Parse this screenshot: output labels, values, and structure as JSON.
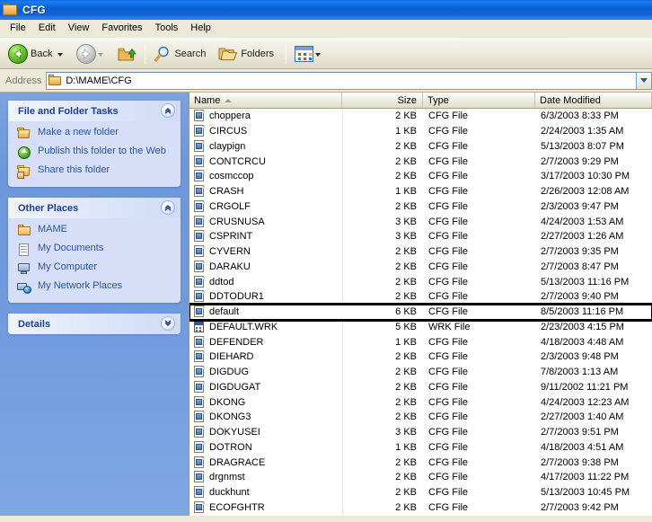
{
  "window": {
    "title": "CFG",
    "folder_icon": "folder-icon"
  },
  "menu": {
    "items": [
      {
        "label": "File"
      },
      {
        "label": "Edit"
      },
      {
        "label": "View"
      },
      {
        "label": "Favorites"
      },
      {
        "label": "Tools"
      },
      {
        "label": "Help"
      }
    ]
  },
  "toolbar": {
    "back_label": "Back",
    "search_label": "Search",
    "folders_label": "Folders",
    "back_icon": "back-arrow-icon",
    "forward_icon": "forward-arrow-icon",
    "up_icon": "up-one-level-icon",
    "search_icon": "search-magnifier-icon",
    "folders_icon": "folders-icon",
    "views_icon": "views-icon"
  },
  "address": {
    "label": "Address",
    "value": "D:\\MAME\\CFG",
    "folder_icon": "folder-icon",
    "dropdown_icon": "chevron-down-icon"
  },
  "sidebar": {
    "panels": [
      {
        "title": "File and Folder Tasks",
        "collapse_icon": "chevron-up-icon",
        "links": [
          {
            "label": "Make a new folder",
            "icon": "new-folder-icon"
          },
          {
            "label": "Publish this folder to the Web",
            "icon": "publish-web-icon"
          },
          {
            "label": "Share this folder",
            "icon": "share-folder-icon"
          }
        ]
      },
      {
        "title": "Other Places",
        "collapse_icon": "chevron-up-icon",
        "links": [
          {
            "label": "MAME",
            "icon": "folder-icon"
          },
          {
            "label": "My Documents",
            "icon": "my-documents-icon"
          },
          {
            "label": "My Computer",
            "icon": "my-computer-icon"
          },
          {
            "label": "My Network Places",
            "icon": "my-network-places-icon"
          }
        ]
      },
      {
        "title": "Details",
        "collapse_icon": "chevron-down-icon",
        "links": []
      }
    ]
  },
  "filelist": {
    "columns": [
      {
        "key": "name",
        "label": "Name",
        "sorted": true,
        "sort_icon": "sort-ascending-icon"
      },
      {
        "key": "size",
        "label": "Size"
      },
      {
        "key": "type",
        "label": "Type"
      },
      {
        "key": "date",
        "label": "Date Modified"
      }
    ],
    "rows": [
      {
        "name": "choppera",
        "size": "2 KB",
        "type": "CFG File",
        "date": "6/3/2003 8:33 PM",
        "icon": "cfg-file-icon",
        "marked": false
      },
      {
        "name": "CIRCUS",
        "size": "1 KB",
        "type": "CFG File",
        "date": "2/24/2003 1:35 AM",
        "icon": "cfg-file-icon",
        "marked": false
      },
      {
        "name": "claypign",
        "size": "2 KB",
        "type": "CFG File",
        "date": "5/13/2003 8:07 PM",
        "icon": "cfg-file-icon",
        "marked": false
      },
      {
        "name": "CONTCRCU",
        "size": "2 KB",
        "type": "CFG File",
        "date": "2/7/2003 9:29 PM",
        "icon": "cfg-file-icon",
        "marked": false
      },
      {
        "name": "cosmccop",
        "size": "2 KB",
        "type": "CFG File",
        "date": "3/17/2003 10:30 PM",
        "icon": "cfg-file-icon",
        "marked": false
      },
      {
        "name": "CRASH",
        "size": "1 KB",
        "type": "CFG File",
        "date": "2/26/2003 12:08 AM",
        "icon": "cfg-file-icon",
        "marked": false
      },
      {
        "name": "CRGOLF",
        "size": "2 KB",
        "type": "CFG File",
        "date": "2/3/2003 9:47 PM",
        "icon": "cfg-file-icon",
        "marked": false
      },
      {
        "name": "CRUSNUSA",
        "size": "3 KB",
        "type": "CFG File",
        "date": "4/24/2003 1:53 AM",
        "icon": "cfg-file-icon",
        "marked": false
      },
      {
        "name": "CSPRINT",
        "size": "3 KB",
        "type": "CFG File",
        "date": "2/27/2003 1:26 AM",
        "icon": "cfg-file-icon",
        "marked": false
      },
      {
        "name": "CYVERN",
        "size": "2 KB",
        "type": "CFG File",
        "date": "2/7/2003 9:35 PM",
        "icon": "cfg-file-icon",
        "marked": false
      },
      {
        "name": "DARAKU",
        "size": "2 KB",
        "type": "CFG File",
        "date": "2/7/2003 8:47 PM",
        "icon": "cfg-file-icon",
        "marked": false
      },
      {
        "name": "ddtod",
        "size": "2 KB",
        "type": "CFG File",
        "date": "5/13/2003 11:16 PM",
        "icon": "cfg-file-icon",
        "marked": false
      },
      {
        "name": "DDTODUR1",
        "size": "2 KB",
        "type": "CFG File",
        "date": "2/7/2003 9:40 PM",
        "icon": "cfg-file-icon",
        "marked": false
      },
      {
        "name": "default",
        "size": "6 KB",
        "type": "CFG File",
        "date": "8/5/2003 11:16 PM",
        "icon": "cfg-file-icon",
        "marked": true
      },
      {
        "name": "DEFAULT.WRK",
        "size": "5 KB",
        "type": "WRK File",
        "date": "2/23/2003 4:15 PM",
        "icon": "wrk-file-icon",
        "marked": false
      },
      {
        "name": "DEFENDER",
        "size": "1 KB",
        "type": "CFG File",
        "date": "4/18/2003 4:48 AM",
        "icon": "cfg-file-icon",
        "marked": false
      },
      {
        "name": "DIEHARD",
        "size": "2 KB",
        "type": "CFG File",
        "date": "2/3/2003 9:48 PM",
        "icon": "cfg-file-icon",
        "marked": false
      },
      {
        "name": "DIGDUG",
        "size": "2 KB",
        "type": "CFG File",
        "date": "7/8/2003 1:13 AM",
        "icon": "cfg-file-icon",
        "marked": false
      },
      {
        "name": "DIGDUGAT",
        "size": "2 KB",
        "type": "CFG File",
        "date": "9/11/2002 11:21 PM",
        "icon": "cfg-file-icon",
        "marked": false
      },
      {
        "name": "DKONG",
        "size": "2 KB",
        "type": "CFG File",
        "date": "4/24/2003 12:23 AM",
        "icon": "cfg-file-icon",
        "marked": false
      },
      {
        "name": "DKONG3",
        "size": "2 KB",
        "type": "CFG File",
        "date": "2/27/2003 1:40 AM",
        "icon": "cfg-file-icon",
        "marked": false
      },
      {
        "name": "DOKYUSEI",
        "size": "3 KB",
        "type": "CFG File",
        "date": "2/7/2003 9:51 PM",
        "icon": "cfg-file-icon",
        "marked": false
      },
      {
        "name": "DOTRON",
        "size": "1 KB",
        "type": "CFG File",
        "date": "4/18/2003 4:51 AM",
        "icon": "cfg-file-icon",
        "marked": false
      },
      {
        "name": "DRAGRACE",
        "size": "2 KB",
        "type": "CFG File",
        "date": "2/7/2003 9:38 PM",
        "icon": "cfg-file-icon",
        "marked": false
      },
      {
        "name": "drgnmst",
        "size": "2 KB",
        "type": "CFG File",
        "date": "4/17/2003 11:22 PM",
        "icon": "cfg-file-icon",
        "marked": false
      },
      {
        "name": "duckhunt",
        "size": "2 KB",
        "type": "CFG File",
        "date": "5/13/2003 10:45 PM",
        "icon": "cfg-file-icon",
        "marked": false
      },
      {
        "name": "ECOFGHTR",
        "size": "2 KB",
        "type": "CFG File",
        "date": "2/7/2003 9:42 PM",
        "icon": "cfg-file-icon",
        "marked": false
      }
    ]
  },
  "colors": {
    "titlebar_blue": "#0b5ed0",
    "sidebar_blue": "#7190d8",
    "panel_body": "#d6dff7",
    "link_blue": "#2a53a8",
    "chrome_tan": "#ece9d8",
    "marker_black": "#000000"
  }
}
